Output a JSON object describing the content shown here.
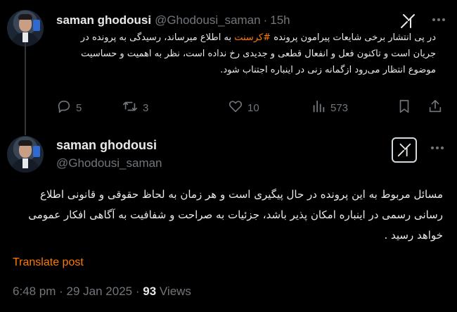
{
  "tweet1": {
    "display_name": "saman ghodousi",
    "handle": "@Ghodousi_saman",
    "separator": "·",
    "time": "15h",
    "text_before_hashtag": "در پی انتشار برخی شایعات پیرامون پرونده ",
    "hashtag": "#کرسنت",
    "text_after_hashtag": " به اطلاع میرساند، رسیدگی به پرونده در جریان است و تاکنون فعل و انفعال قطعی و جدیدی رخ نداده است، نظر به اهمیت و حساسیت موضوع انتظار می‌رود ازگمانه زنی در اینباره اجتناب شود.",
    "stats": {
      "replies": "5",
      "reposts": "3",
      "likes": "10",
      "views": "573"
    }
  },
  "tweet2": {
    "display_name": "saman ghodousi",
    "handle": "@Ghodousi_saman",
    "text": "مسائل مربوط به این پرونده در حال پیگیری است و هر زمان به لحاظ حقوقی و قانونی اطلاع رسانی رسمی در اینباره امکان پذیر باشد، جزئیات به صراحت و شفافیت به آگاهی افکار عمومی خواهد رسید .",
    "translate_label": "Translate post",
    "timestamp": "6:48 pm · 29 Jan 2025 · ",
    "views_count": "93",
    "views_label": " Views"
  },
  "colors": {
    "background": "#000000",
    "primary_text": "#e7e9ea",
    "secondary_text": "#71767b",
    "accent": "#ff7a00"
  },
  "icons": [
    "grok-icon",
    "more-icon",
    "reply-icon",
    "repost-icon",
    "like-icon",
    "views-icon",
    "bookmark-icon",
    "share-icon"
  ]
}
